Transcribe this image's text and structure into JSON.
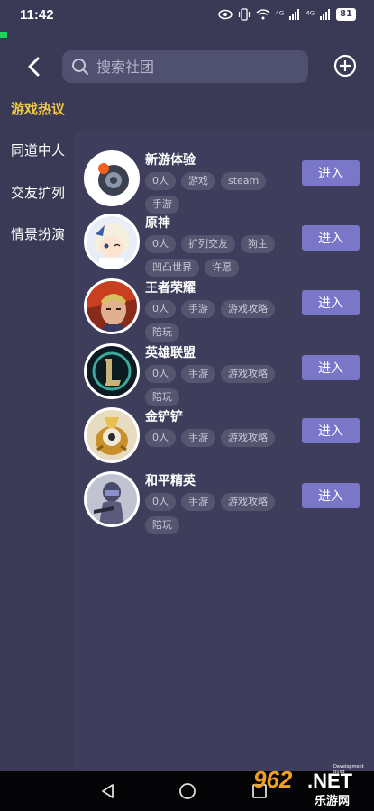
{
  "status": {
    "time": "11:42",
    "signal_1": "⁴ᴳ",
    "signal_2": "⁴ᴳ",
    "battery": "81"
  },
  "header": {
    "search_placeholder": "搜索社团"
  },
  "sidebar": {
    "items": [
      {
        "label": "游戏热议",
        "active": true
      },
      {
        "label": "同道中人"
      },
      {
        "label": "交友扩列"
      },
      {
        "label": "情景扮演"
      }
    ]
  },
  "clubs": [
    {
      "name": "新游体验",
      "tags": [
        "0人",
        "游戏",
        "steam",
        "手游"
      ],
      "button": "进入",
      "icon": "xinyou-disc-icon"
    },
    {
      "name": "原神",
      "tags": [
        "0人",
        "扩列交友",
        "狗主",
        "凹凸世界",
        "许愿"
      ],
      "button": "进入",
      "icon": "genshin-character-icon"
    },
    {
      "name": "王者荣耀",
      "tags": [
        "0人",
        "手游",
        "游戏攻略",
        "陪玩"
      ],
      "button": "进入",
      "icon": "honor-of-kings-hero-icon"
    },
    {
      "name": "英雄联盟",
      "tags": [
        "0人",
        "手游",
        "游戏攻略",
        "陪玩"
      ],
      "button": "进入",
      "icon": "lol-logo-icon"
    },
    {
      "name": "金铲铲",
      "tags": [
        "0人",
        "手游",
        "游戏攻略"
      ],
      "button": "进入",
      "icon": "golden-spatula-icon"
    },
    {
      "name": "和平精英",
      "tags": [
        "0人",
        "手游",
        "游戏攻略",
        "陪玩"
      ],
      "button": "进入",
      "icon": "peace-elite-soldier-icon"
    }
  ],
  "footer": {
    "dev_build": "Development Build",
    "watermark_962": "962",
    "watermark_net": ".NET",
    "watermark_sub": "乐游网"
  },
  "colors": {
    "background": "#3a3a56",
    "active": "#f0c94a",
    "button": "#7a77c8"
  }
}
